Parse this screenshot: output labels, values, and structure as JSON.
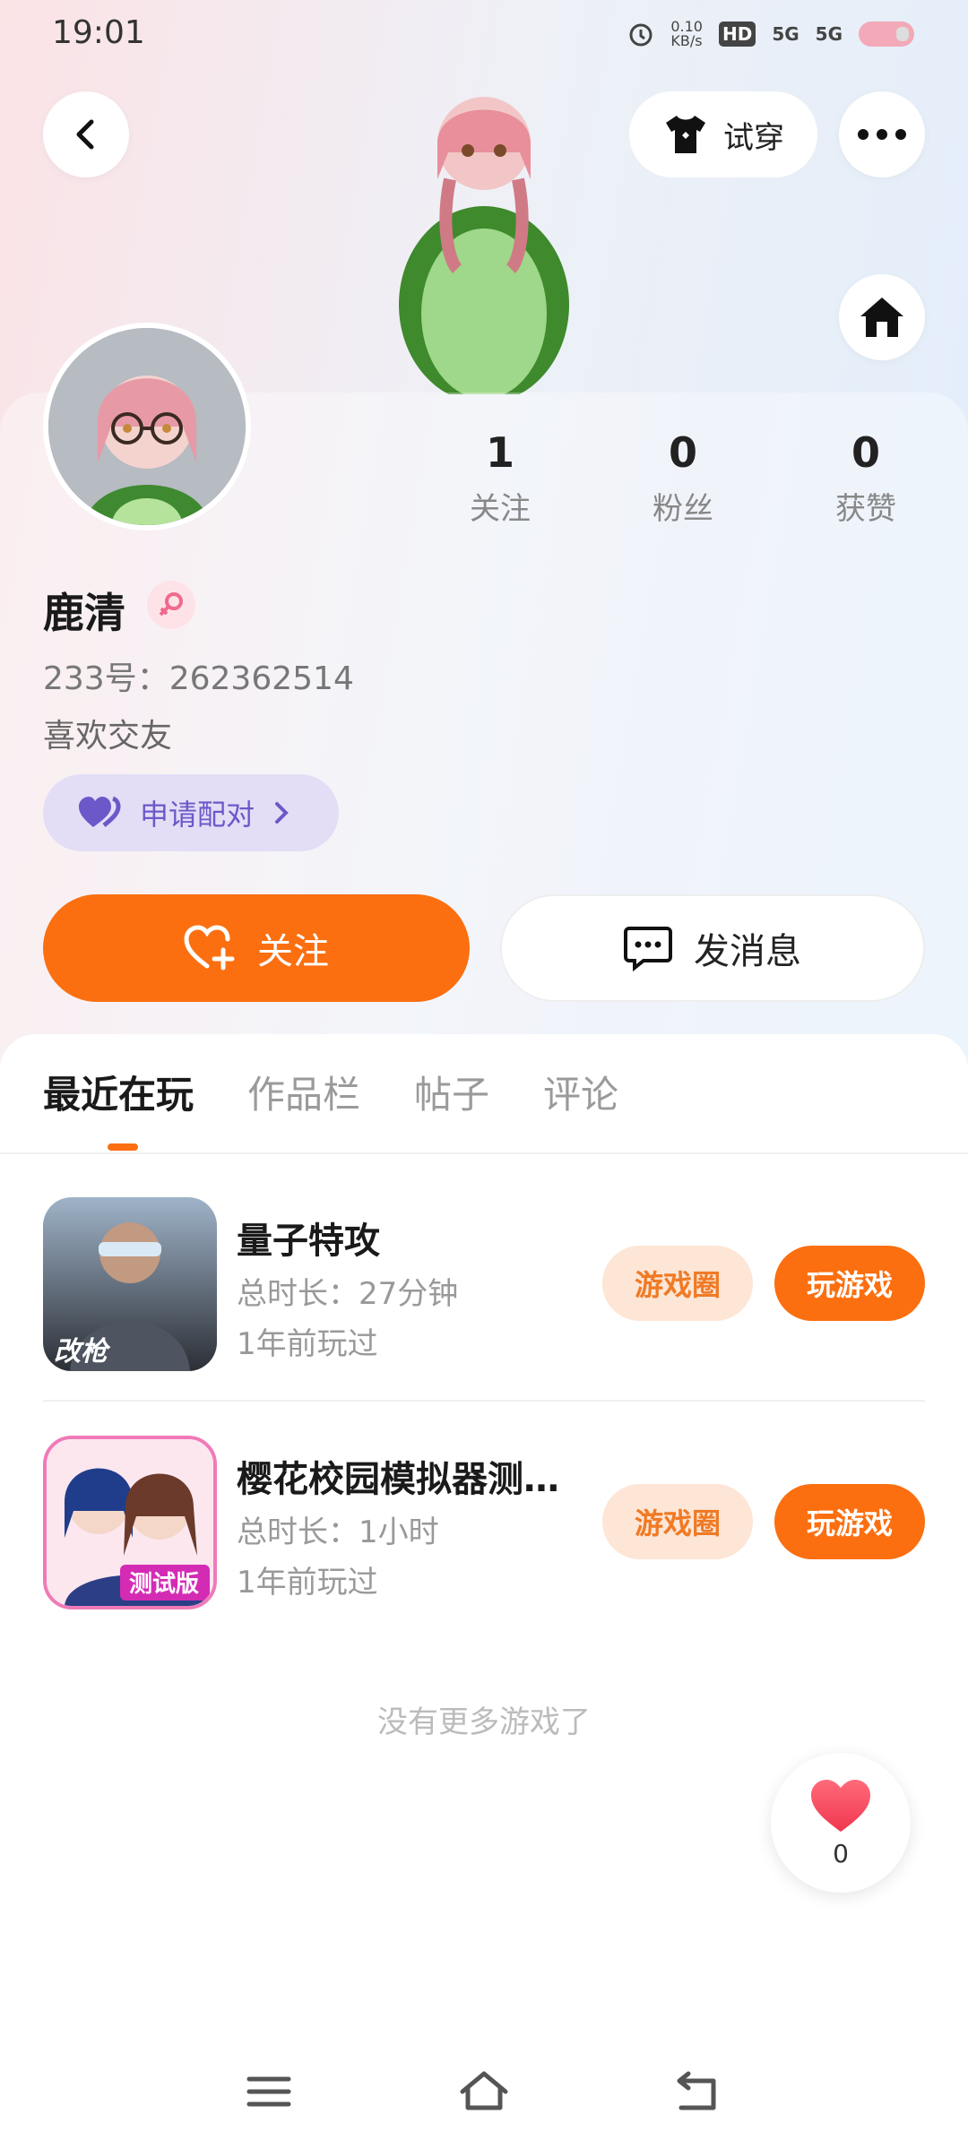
{
  "status_bar": {
    "time": "19:01",
    "net_speed": "0.10\nKB/s",
    "hd_label": "HD",
    "sig1": "5G",
    "sig2": "5G"
  },
  "header": {
    "back_icon": "chevron-left-icon",
    "try_on_label": "试穿",
    "more_icon": "more-icon",
    "home_icon": "home-icon"
  },
  "profile": {
    "name": "鹿清",
    "gender_icon": "female-icon",
    "id_line": "233号：262362514",
    "bio": "喜欢交友",
    "pair_label": "申请配对",
    "stats": [
      {
        "value": "1",
        "label": "关注"
      },
      {
        "value": "0",
        "label": "粉丝"
      },
      {
        "value": "0",
        "label": "获赞"
      }
    ]
  },
  "actions": {
    "follow_label": "关注",
    "message_label": "发消息"
  },
  "tabs": [
    {
      "label": "最近在玩",
      "active": true
    },
    {
      "label": "作品栏",
      "active": false
    },
    {
      "label": "帖子",
      "active": false
    },
    {
      "label": "评论",
      "active": false
    }
  ],
  "games": [
    {
      "title": "量子特攻",
      "duration": "总时长：27分钟",
      "last_played": "1年前玩过",
      "icon_badge": "改枪",
      "circle_label": "游戏圈",
      "play_label": "玩游戏"
    },
    {
      "title": "樱花校园模拟器测…",
      "duration": "总时长：1小时",
      "last_played": "1年前玩过",
      "icon_badge": "测试版",
      "circle_label": "游戏圈",
      "play_label": "玩游戏"
    }
  ],
  "list_footer": "没有更多游戏了",
  "like_fab": {
    "count": "0"
  },
  "colors": {
    "accent": "#fb6f10",
    "accent_soft": "#fde6d6",
    "pair_bg": "#e3def6",
    "pair_text": "#6d58c9"
  }
}
